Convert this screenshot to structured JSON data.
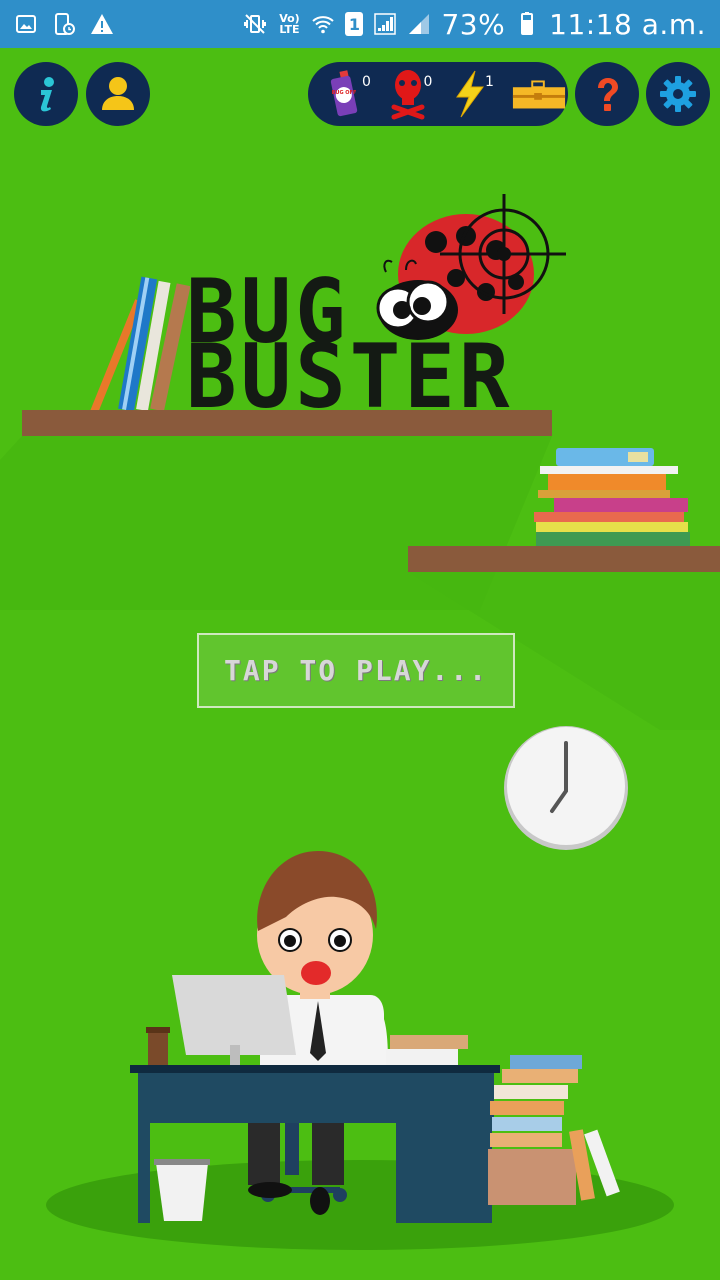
{
  "status_bar": {
    "lte_top": "Vo)",
    "lte_bottom": "LTE",
    "sim": "1",
    "battery": "73%",
    "time": "11:18 a.m."
  },
  "header": {
    "inventory": [
      {
        "name": "bug-spray",
        "count": "0"
      },
      {
        "name": "poison",
        "count": "0"
      },
      {
        "name": "lightning",
        "count": "1"
      },
      {
        "name": "toolbox",
        "count": ""
      }
    ],
    "spray_label": "BUG OFF"
  },
  "title": {
    "line1": "BUG",
    "line2": "BUSTER"
  },
  "play_button": {
    "label": "TAP TO PLAY..."
  },
  "colors": {
    "background": "#4cbe12",
    "status_bar": "#2f8fc9",
    "button_bg": "#0f2a52",
    "info_icon": "#2bc6d6",
    "profile_icon": "#f5c518",
    "help_icon": "#f04a24",
    "settings_icon": "#1ea0e0",
    "shelf": "#8a5a3c"
  }
}
